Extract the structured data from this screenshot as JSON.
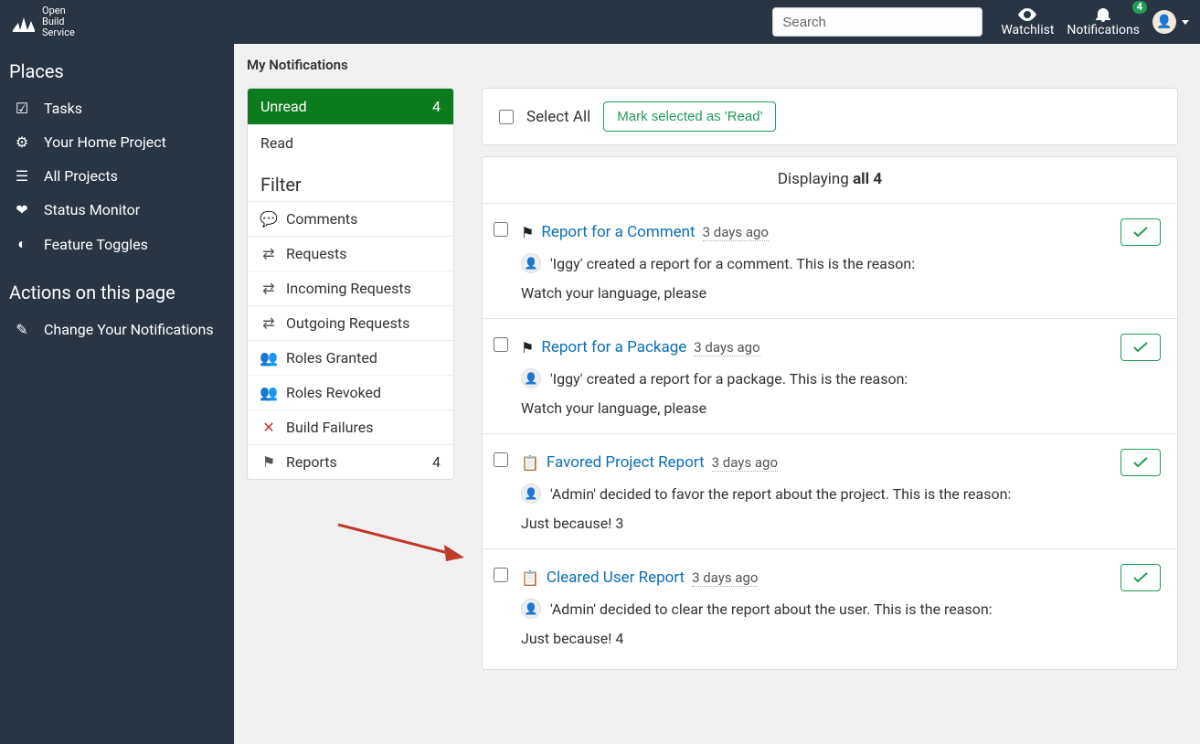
{
  "brand": {
    "line1": "Open",
    "line2": "Build",
    "line3": "Service"
  },
  "search": {
    "placeholder": "Search"
  },
  "topnav": {
    "watchlist": "Watchlist",
    "notifications": "Notifications",
    "notif_count": "4"
  },
  "sidebar": {
    "places_header": "Places",
    "items": [
      {
        "label": "Tasks"
      },
      {
        "label": "Your Home Project"
      },
      {
        "label": "All Projects"
      },
      {
        "label": "Status Monitor"
      },
      {
        "label": "Feature Toggles"
      }
    ],
    "actions_header": "Actions on this page",
    "action1": "Change Your Notifications"
  },
  "page": {
    "title": "My Notifications"
  },
  "filters": {
    "unread": {
      "label": "Unread",
      "count": "4"
    },
    "read": {
      "label": "Read"
    },
    "header": "Filter",
    "items": [
      {
        "label": "Comments"
      },
      {
        "label": "Requests"
      },
      {
        "label": "Incoming Requests"
      },
      {
        "label": "Outgoing Requests"
      },
      {
        "label": "Roles Granted"
      },
      {
        "label": "Roles Revoked"
      },
      {
        "label": "Build Failures"
      },
      {
        "label": "Reports",
        "count": "4"
      }
    ]
  },
  "bar": {
    "select_all": "Select All",
    "mark_read": "Mark selected as 'Read'"
  },
  "list": {
    "displaying_prefix": "Displaying ",
    "displaying_bold": "all 4",
    "items": [
      {
        "title": "Report for a Comment",
        "time": "3 days ago",
        "subtext": "'Iggy' created a report for a comment. This is the reason:",
        "reason": "Watch your language, please",
        "icon": "flag"
      },
      {
        "title": "Report for a Package",
        "time": "3 days ago",
        "subtext": "'Iggy' created a report for a package. This is the reason:",
        "reason": "Watch your language, please",
        "icon": "flag"
      },
      {
        "title": "Favored Project Report",
        "time": "3 days ago",
        "subtext": "'Admin' decided to favor the report about the project. This is the reason:",
        "reason": "Just because! 3",
        "icon": "clipboard"
      },
      {
        "title": "Cleared User Report",
        "time": "3 days ago",
        "subtext": "'Admin' decided to clear the report about the user. This is the reason:",
        "reason": "Just because! 4",
        "icon": "clipboard"
      }
    ]
  }
}
